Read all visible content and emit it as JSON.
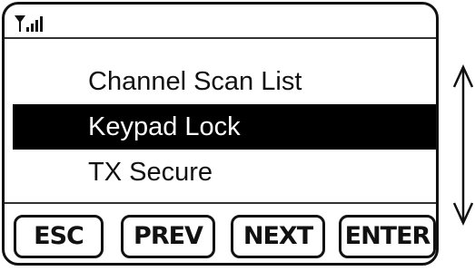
{
  "status_bar": {
    "signal_icon": "signal-strength-icon",
    "signal_bars": 4
  },
  "menu": {
    "items": [
      {
        "label": "Channel Scan List",
        "selected": false
      },
      {
        "label": "Keypad Lock",
        "selected": true
      },
      {
        "label": "TX Secure",
        "selected": false
      }
    ]
  },
  "softkeys": {
    "esc_label": "ESC",
    "prev_label": "PREV",
    "next_label": "NEXT",
    "enter_label": "ENTER"
  },
  "scroll_indicator": {
    "icon": "up-down-arrow-icon"
  },
  "colors": {
    "highlight_bg": "#000000",
    "highlight_text": "#ffffff",
    "text": "#111111"
  }
}
